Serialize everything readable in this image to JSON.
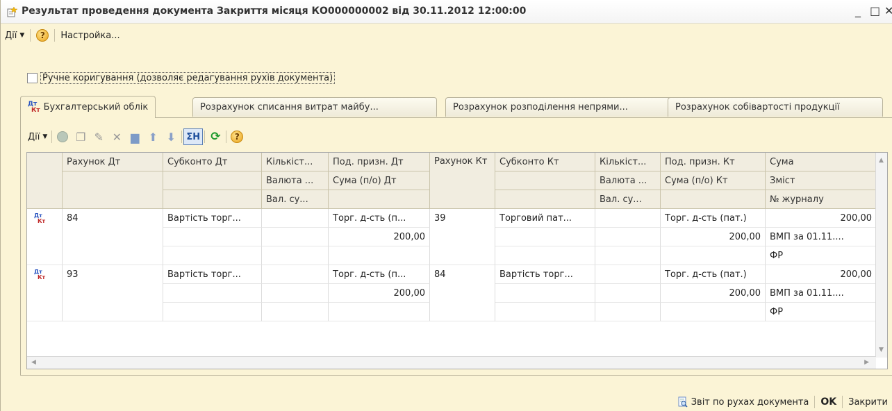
{
  "window": {
    "title": "Результат проведення документа Закриття місяця КО000000002 від 30.11.2012 12:00:00",
    "minimize": "_",
    "maximize": "□",
    "close": "✕"
  },
  "toolbar": {
    "actions_label": "Дії",
    "help": "?",
    "settings_label": "Настройка..."
  },
  "manual_edit": {
    "label": "Ручне коригування (дозволяє редагування рухів документа)",
    "checked": false
  },
  "tabs": [
    {
      "label": "Бухгалтерський облік",
      "active": true
    },
    {
      "label": "Розрахунок списання витрат майбу...",
      "active": false
    },
    {
      "label": "Розрахунок розподілення непрями...",
      "active": false
    },
    {
      "label": "Розрахунок собівартості продукції",
      "active": false
    }
  ],
  "tab_icon": {
    "dt": "Дт",
    "kt": "Кт"
  },
  "grid_toolbar": {
    "actions_label": "Дії",
    "sum_label": "ΣН",
    "icons": [
      "add-icon",
      "copy-icon",
      "edit-icon",
      "delete-icon",
      "save-icon",
      "move-up-icon",
      "move-down-icon",
      "sum-icon",
      "refresh-icon",
      "help-icon"
    ]
  },
  "grid": {
    "headers": {
      "acc_dt": "Рахунок Дт",
      "sub_dt": "Субконто Дт",
      "qty_dt": "Кількіст...",
      "cur_dt": "Валюта ...",
      "cursum_dt": "Вал. су...",
      "tax_dt": "Под. призн. Дт",
      "taxsum_dt": "Сума (п/о) Дт",
      "acc_kt": "Рахунок Кт",
      "sub_kt": "Субконто Кт",
      "qty_kt": "Кількіст...",
      "cur_kt": "Валюта ...",
      "cursum_kt": "Вал. су...",
      "tax_kt": "Под. призн. Кт",
      "taxsum_kt": "Сума (п/о) Кт",
      "sum": "Сума",
      "content": "Зміст",
      "journal": "№ журналу"
    },
    "rows": [
      {
        "acc_dt": "84",
        "sub_dt": "Вартість торг...",
        "tax_dt": "Торг. д-сть (п...",
        "taxsum_dt": "200,00",
        "acc_kt": "39",
        "sub_kt": "Торговий пат...",
        "tax_kt": "Торг. д-сть (пат.)",
        "taxsum_kt": "200,00",
        "sum": "200,00",
        "content": "ВМП за 01.11....",
        "journal": "ФР"
      },
      {
        "acc_dt": "93",
        "sub_dt": "Вартість торг...",
        "tax_dt": "Торг. д-сть (п...",
        "taxsum_dt": "200,00",
        "acc_kt": "84",
        "sub_kt": "Вартість торг...",
        "tax_kt": "Торг. д-сть (пат.)",
        "taxsum_kt": "200,00",
        "sum": "200,00",
        "content": "ВМП за 01.11....",
        "journal": "ФР"
      }
    ]
  },
  "footer": {
    "report_label": "Звіт по рухах документа",
    "ok_label": "OK",
    "close_label": "Закрити"
  }
}
